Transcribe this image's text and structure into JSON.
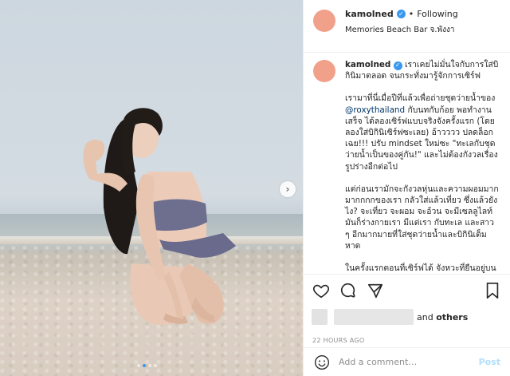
{
  "post": {
    "username": "kamolned",
    "separator": "•",
    "follow_status": "Following",
    "location": "Memories Beach Bar จ.พังงา",
    "avatar_color": "#f1a08a",
    "accent_color": "#3897f0"
  },
  "caption": {
    "username": "kamolned",
    "intro": "เราเคยไม่มั่นใจกับการใส่บิกินิมาตลอด จนกระทั่งมารู้จักการเซิร์ฟ",
    "p1_before_mention": "เรามาที่นี่เมื่อปีที่แล้วเพื่อถ่ายชุดว่ายน้ำของ",
    "p1_mention": "@roxythailand",
    "p1_after_mention": "กับนทกับก้อย พอทำงานเสร็จ ได้ลองเซิร์ฟแบบจริงจังครั้งแรก (โดยลองใส่บิกินิเซิร์ฟซะเลย) อ้าวววว ปลดล็อกเฉย!!! ปรับ mindset ใหม่ซะ \"ทะเลกับชุดว่ายน้ำเป็นของคู่กัน!\" และไม่ต้องกังวลเรื่องรูปร่างอีกต่อไป",
    "p2": "แต่ก่อนเรามักจะกังวลหุ่นและความผอมมากมากกกกของเรา กลัวใส่แล้วเที่ยว ซึ่งแล้วยังไง? จะเที่ยว จะผอม จะอ้วน จะมีเซลลูไลท์ มันก็ร่างกายเรา มีแต่เรา กับทะเล และสาว ๆ อีกมากมายที่ใส่ชุดว่ายน้ำและบิกินิเต็มหาด",
    "p3": "ในครั้งแรกตอนที่เซิร์ฟได้ จังหวะที่ยืนอยู่บนเซิร์ฟด้วยชุดบิกินิมันคือโมเมนต์แห่งความ"
  },
  "engagement": {
    "likes_suffix": "and",
    "likes_others": "others",
    "timestamp": "22 HOURS AGO"
  },
  "comment_box": {
    "placeholder": "Add a comment…",
    "post_label": "Post",
    "post_color": "#b2dffc"
  },
  "carousel": {
    "image_count": 4,
    "active_index": 1
  },
  "icons": {
    "verified": "verified-badge-icon",
    "like": "heart-icon",
    "comment": "comment-bubble-icon",
    "share": "paper-plane-icon",
    "save": "bookmark-icon",
    "next": "chevron-right-icon",
    "emoji": "smiley-icon"
  }
}
